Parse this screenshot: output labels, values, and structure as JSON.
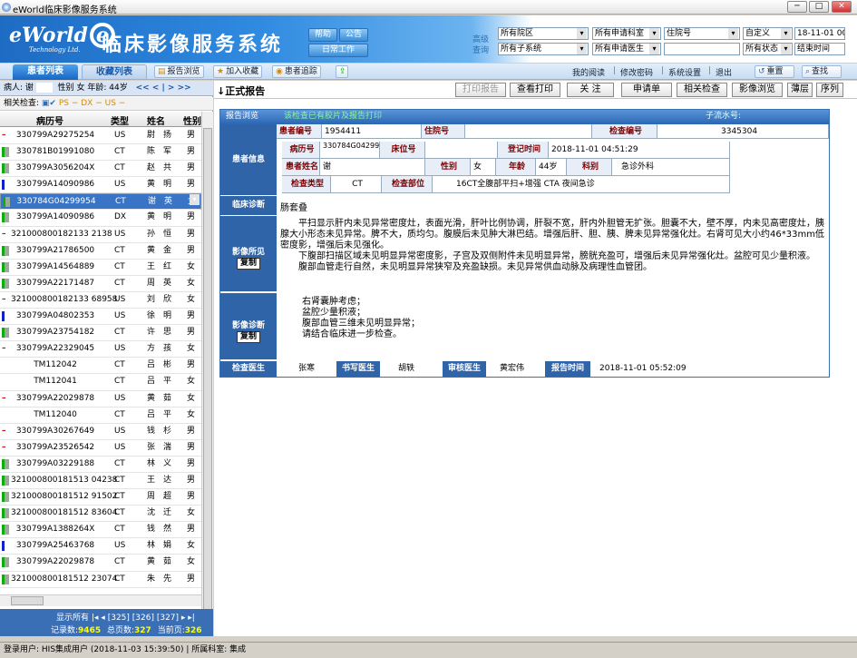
{
  "window": {
    "title": "eWorld临床影像服务系统",
    "min": "─",
    "max": "□",
    "close": "✕"
  },
  "header": {
    "logo": "eWorld",
    "logo_e": "e",
    "logo_sub": "Technology Ltd.",
    "title": "临床影像服务系统",
    "help": "帮助",
    "notice": "公告",
    "daily": "日常工作",
    "query_label_1": "高级",
    "query_label_2": "查询",
    "sel_hospital": "所有院区",
    "sel_dept": "所有申请科室",
    "sel_visit": "住院号",
    "sel_custom": "自定义",
    "date_start": "18-11-01 00",
    "sel_subsystem": "所有子系统",
    "sel_doctor": "所有申请医生",
    "sel_status": "所有状态",
    "end_time": "结束时间"
  },
  "toolbar": {
    "tab_patients": "患者列表",
    "tab_favorites": "收藏列表",
    "btn_report_browse": "报告浏览",
    "btn_add_fav": "加入收藏",
    "btn_trace": "患者追踪",
    "link_read": "我的阅读",
    "link_pwd": "修改密码",
    "link_settings": "系统设置",
    "link_exit": "退出",
    "btn_reset": "重置",
    "btn_search": "查找"
  },
  "patient_bar": {
    "name_label": "病人:",
    "name": "谢",
    "sex_label": "性别",
    "sex": "女",
    "age_label": "年龄:",
    "age": "44岁",
    "nav": "<<  <  |  >  >>"
  },
  "related_bar": {
    "label": "相关检查:",
    "items": "PS  −    DX  −    US  −"
  },
  "list": {
    "columns": [
      "病历号",
      "类型",
      "姓名",
      "性别"
    ],
    "rows": [
      {
        "id": "330799A29275254",
        "type": "US",
        "name": "尉",
        "name2": "扬",
        "sex": "男",
        "mark": "red"
      },
      {
        "id": "330781B01991080",
        "type": "CT",
        "name": "陈",
        "name2": "军",
        "sex": "男",
        "mark": "green"
      },
      {
        "id": "330799A3056204X",
        "type": "CT",
        "name": "赵",
        "name2": "共",
        "sex": "男",
        "mark": "green"
      },
      {
        "id": "330799A14090986",
        "type": "US",
        "name": "黄",
        "name2": "明",
        "sex": "男",
        "mark": "blue"
      },
      {
        "id": "330784G04299954",
        "type": "CT",
        "name": "谢",
        "name2": "英",
        "sex": "女",
        "mark": "green"
      },
      {
        "id": "330799A14090986",
        "type": "DX",
        "name": "黄",
        "name2": "明",
        "sex": "男",
        "mark": "green"
      },
      {
        "id": "321000800182133 2138",
        "type": "US",
        "name": "孙",
        "name2": "恒",
        "sex": "男",
        "mark": "red"
      },
      {
        "id": "330799A21786500",
        "type": "CT",
        "name": "黄",
        "name2": "金",
        "sex": "男",
        "mark": "green"
      },
      {
        "id": "330799A14564889",
        "type": "CT",
        "name": "王",
        "name2": "红",
        "sex": "女",
        "mark": "green"
      },
      {
        "id": "330799A22171487",
        "type": "CT",
        "name": "周",
        "name2": "英",
        "sex": "女",
        "mark": "green"
      },
      {
        "id": "321000800182133 68958",
        "type": "US",
        "name": "刘",
        "name2": "欣",
        "sex": "女",
        "mark": "red"
      },
      {
        "id": "330799A04802353",
        "type": "US",
        "name": "徐",
        "name2": "明",
        "sex": "男",
        "mark": "blue"
      },
      {
        "id": "330799A23754182",
        "type": "CT",
        "name": "许",
        "name2": "思",
        "sex": "男",
        "mark": "green"
      },
      {
        "id": "330799A22329045",
        "type": "US",
        "name": "方",
        "name2": "孩",
        "sex": "女",
        "mark": "red"
      },
      {
        "id": "TM112042",
        "type": "CT",
        "name": "吕",
        "name2": "彬",
        "sex": "男",
        "mark": "none"
      },
      {
        "id": "TM112041",
        "type": "CT",
        "name": "吕",
        "name2": "平",
        "sex": "女",
        "mark": "none"
      },
      {
        "id": "330799A22029878",
        "type": "US",
        "name": "黄",
        "name2": "茹",
        "sex": "女",
        "mark": "red"
      },
      {
        "id": "TM112040",
        "type": "CT",
        "name": "吕",
        "name2": "平",
        "sex": "女",
        "mark": "none"
      },
      {
        "id": "330799A30267649",
        "type": "US",
        "name": "钱",
        "name2": "杉",
        "sex": "男",
        "mark": "red"
      },
      {
        "id": "330799A23526542",
        "type": "US",
        "name": "张",
        "name2": "湍",
        "sex": "男",
        "mark": "red"
      },
      {
        "id": "330799A03229188",
        "type": "CT",
        "name": "林",
        "name2": "义",
        "sex": "男",
        "mark": "green"
      },
      {
        "id": "321000800181513 04238",
        "type": "CT",
        "name": "王",
        "name2": "达",
        "sex": "男",
        "mark": "green"
      },
      {
        "id": "321000800181512 91502",
        "type": "CT",
        "name": "周",
        "name2": "超",
        "sex": "男",
        "mark": "green"
      },
      {
        "id": "321000800181512 83604",
        "type": "CT",
        "name": "沈",
        "name2": "迁",
        "sex": "女",
        "mark": "green"
      },
      {
        "id": "330799A1388264X",
        "type": "CT",
        "name": "钱",
        "name2": "然",
        "sex": "男",
        "mark": "green"
      },
      {
        "id": "330799A25463768",
        "type": "US",
        "name": "林",
        "name2": "娟",
        "sex": "女",
        "mark": "blue"
      },
      {
        "id": "330799A22029878",
        "type": "CT",
        "name": "黄",
        "name2": "茹",
        "sex": "女",
        "mark": "green"
      },
      {
        "id": "321000800181512 23074",
        "type": "CT",
        "name": "朱",
        "name2": "先",
        "sex": "男",
        "mark": "green"
      }
    ]
  },
  "pager": {
    "show_all": "显示所有",
    "pages": "[325] [326] [327]",
    "records_label": "记录数:",
    "records": "9465",
    "total_label": "总页数:",
    "total": "327",
    "current_label": "当前页:",
    "current": "326"
  },
  "report_bar": {
    "title": "正式报告",
    "btn_print": "打印报告",
    "btn_view_print": "查看打印",
    "btn_follow": "关 注",
    "btn_apply": "申请单",
    "btn_related": "相关检查",
    "btn_image": "影像浏览",
    "btn_thin": "薄层",
    "btn_sequence": "序列"
  },
  "report": {
    "header_left": "报告浏览",
    "header_mid": "该检查已有胶片及报告打印",
    "header_right_label": "子流水号:",
    "patient_section": "患者信息",
    "patient_no_label": "患者编号",
    "patient_no": "1954411",
    "inpatient_label": "住院号",
    "inpatient": "",
    "exam_no_label": "检查编号",
    "exam_no": "3345304",
    "record_label": "病历号",
    "record": "330784G04299954",
    "bed_label": "床位号",
    "bed": "",
    "reg_time_label": "登记时间",
    "reg_time": "2018-11-01 04:51:29",
    "name_label": "患者姓名",
    "name": "谢",
    "sex_label": "性别",
    "sex": "女",
    "age_label": "年龄",
    "age": "44岁",
    "dept_label": "科别",
    "dept": "急诊外科",
    "exam_type_label": "检查类型",
    "exam_type": "CT",
    "exam_part_label": "检查部位",
    "exam_part": "16CT全腹部平扫+增强 CTA 夜间急诊",
    "clinical_label": "临床诊断",
    "clinical": "肠套叠",
    "findings_label": "影像所见",
    "copy": "复制",
    "findings": [
      "平扫显示肝内未见异常密度灶，表面光滑，肝叶比例协调，肝裂不宽，肝内外胆管无扩张。胆囊不大，壁不厚，内未见高密度灶，胰腺大小形态未见异常。脾不大，质均匀。腹膜后未见肿大淋巴结。增强后肝、胆、胰、脾未见异常强化灶。右肾可见大小约46*33mm低密度影，增强后未见强化。",
      "下腹部扫描区域未见明显异常密度影，子宫及双侧附件未见明显异常，膀胱充盈可，增强后未见异常强化灶。盆腔可见少量积液。",
      "腹部血管走行自然，未见明显异常狭窄及充盈缺损。未见异常供血动脉及病理性血管团。"
    ],
    "diagnosis_label": "影像诊断",
    "diagnosis": [
      "右肾囊肿考虑；",
      "盆腔少量积液；",
      "腹部血管三维未见明显异常；",
      "请结合临床进一步检查。"
    ],
    "exam_doctor_label": "检查医生",
    "exam_doctor": "张寒",
    "writer_label": "书写医生",
    "writer": "胡轶",
    "reviewer_label": "审核医生",
    "reviewer": "黄宏伟",
    "report_time_label": "报告时间",
    "report_time": "2018-11-01 05:52:09"
  },
  "status": {
    "text": "登录用户: HIS集成用户 (2018-11-03 15:39:50) | 所属科室: 集成"
  }
}
